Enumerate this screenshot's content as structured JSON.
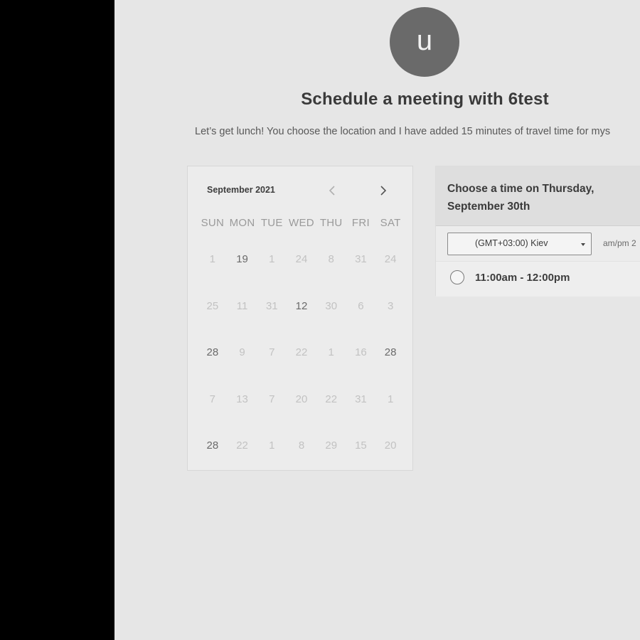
{
  "profile": {
    "initial": "u"
  },
  "header": {
    "title": "Schedule a meeting with 6test",
    "subtitle": "Let’s get lunch! You choose the location and I have added 15 minutes of travel time for mys"
  },
  "calendar": {
    "month_label": "September 2021",
    "prev_icon": "chevron-left-icon",
    "next_icon": "chevron-right-icon",
    "weekdays": [
      "SUN",
      "MON",
      "TUE",
      "WED",
      "THU",
      "FRI",
      "SAT"
    ],
    "days": [
      {
        "label": "1",
        "available": false
      },
      {
        "label": "19",
        "available": true
      },
      {
        "label": "1",
        "available": false
      },
      {
        "label": "24",
        "available": false
      },
      {
        "label": "8",
        "available": false
      },
      {
        "label": "31",
        "available": false
      },
      {
        "label": "24",
        "available": false
      },
      {
        "label": "25",
        "available": false
      },
      {
        "label": "11",
        "available": false
      },
      {
        "label": "31",
        "available": false
      },
      {
        "label": "12",
        "available": true
      },
      {
        "label": "30",
        "available": false
      },
      {
        "label": "6",
        "available": false
      },
      {
        "label": "3",
        "available": false
      },
      {
        "label": "28",
        "available": true
      },
      {
        "label": "9",
        "available": false
      },
      {
        "label": "7",
        "available": false
      },
      {
        "label": "22",
        "available": false
      },
      {
        "label": "1",
        "available": false
      },
      {
        "label": "16",
        "available": false
      },
      {
        "label": "28",
        "available": true
      },
      {
        "label": "7",
        "available": false
      },
      {
        "label": "13",
        "available": false
      },
      {
        "label": "7",
        "available": false
      },
      {
        "label": "20",
        "available": false
      },
      {
        "label": "22",
        "available": false
      },
      {
        "label": "31",
        "available": false
      },
      {
        "label": "1",
        "available": false
      },
      {
        "label": "28",
        "available": true
      },
      {
        "label": "22",
        "available": false
      },
      {
        "label": "1",
        "available": false
      },
      {
        "label": "8",
        "available": false
      },
      {
        "label": "29",
        "available": false
      },
      {
        "label": "15",
        "available": false
      },
      {
        "label": "20",
        "available": false
      }
    ]
  },
  "time_panel": {
    "title": "Choose a time on Thursday, September 30th",
    "timezone": "(GMT+03:00) Kiev",
    "format_toggle": "am/pm  2",
    "slots": [
      {
        "label": "11:00am - 12:00pm",
        "selected": false
      }
    ]
  },
  "colors": {
    "page_bg": "#e6e6e6",
    "avatar_bg": "#6a6a6a",
    "sidebar_bg": "#000000"
  }
}
